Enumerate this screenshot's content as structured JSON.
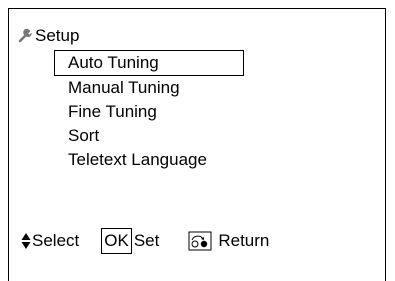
{
  "menu": {
    "title": "Setup",
    "title_icon": "wrench-icon",
    "items": [
      {
        "label": "Auto Tuning",
        "selected": true
      },
      {
        "label": "Manual Tuning",
        "selected": false
      },
      {
        "label": "Fine Tuning",
        "selected": false
      },
      {
        "label": "Sort",
        "selected": false
      },
      {
        "label": "Teletext Language",
        "selected": false
      }
    ]
  },
  "footer": {
    "select_icon": "up-down-arrow-icon",
    "select_label": "Select",
    "ok_key": "OK",
    "set_label": "Set",
    "return_icon": "return-button-icon",
    "return_label": "Return"
  }
}
